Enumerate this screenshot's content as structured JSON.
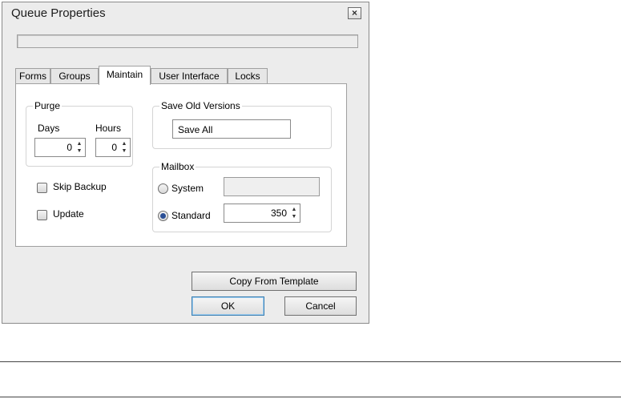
{
  "dialog": {
    "title": "Queue Properties",
    "close_symbol": "×"
  },
  "tabs": [
    {
      "label": "Forms",
      "active": false
    },
    {
      "label": "Groups",
      "active": false
    },
    {
      "label": "Maintain",
      "active": true
    },
    {
      "label": "User Interface",
      "active": false
    },
    {
      "label": "Locks",
      "active": false
    }
  ],
  "purge": {
    "label": "Purge",
    "days_label": "Days",
    "hours_label": "Hours",
    "days_value": "0",
    "hours_value": "0"
  },
  "save_old_versions": {
    "label": "Save Old Versions",
    "value": "Save All"
  },
  "mailbox": {
    "label": "Mailbox",
    "system_label": "System",
    "system_value": "",
    "standard_label": "Standard",
    "standard_value": "350",
    "selected": "Standard"
  },
  "options": {
    "skip_backup_label": "Skip Backup",
    "skip_backup_checked": false,
    "update_label": "Update",
    "update_checked": false
  },
  "buttons": {
    "copy_from_template": "Copy From Template",
    "ok": "OK",
    "cancel": "Cancel"
  }
}
